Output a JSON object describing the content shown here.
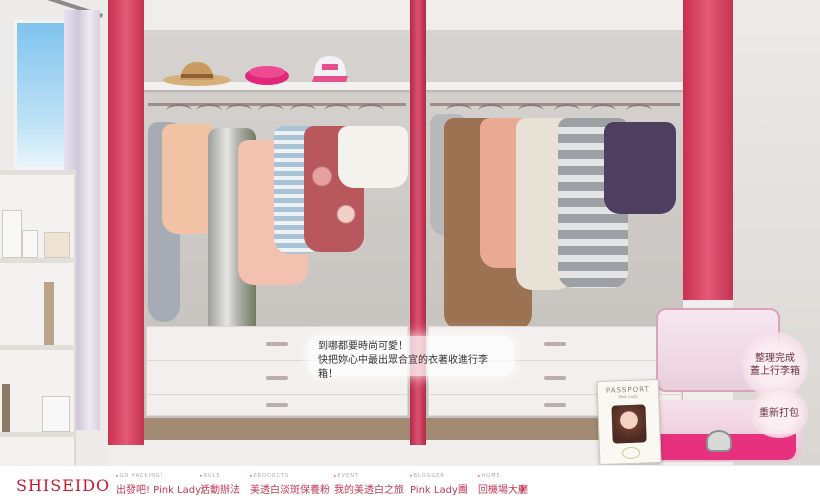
{
  "brand": {
    "logo": "SHISEIDO",
    "accent": "#c5192d",
    "door_pink": "#d9446a"
  },
  "instruction": {
    "line1": "到哪都要時尚可愛！",
    "line2": "快把妳心中最出眾合宜的衣著收進行李箱！"
  },
  "actions": {
    "finish_label": "整理完成 蓋上行李箱",
    "repack_label": "重新打包"
  },
  "passport": {
    "title": "PASSPORT",
    "subtitle": "Pink Lady"
  },
  "nav": {
    "items": [
      {
        "caption": "GO PACKING!",
        "label": "出發吧! Pink Lady!"
      },
      {
        "caption": "RULE",
        "label": "活動辦法"
      },
      {
        "caption": "PRODUCTS",
        "label": "美透白淡斑保養粉"
      },
      {
        "caption": "EVENT",
        "label": "我的美透白之旅"
      },
      {
        "caption": "BLOGGER",
        "label": "Pink Lady團"
      },
      {
        "caption": "HOME",
        "label": "回機場大廳"
      }
    ],
    "home_icon": "airplane-icon"
  },
  "wardrobe": {
    "left_colors": [
      "#a6acb5",
      "#f1c2a4",
      "#c8c8c6",
      "#f2c1b0",
      "#a9c3d6",
      "#c76b6e",
      "#f4f2ec"
    ],
    "right_colors": [
      "#b7b9bb",
      "#9b7353",
      "#e9a993",
      "#e7e1d6",
      "#9fa0a3",
      "#4e3f60"
    ]
  }
}
